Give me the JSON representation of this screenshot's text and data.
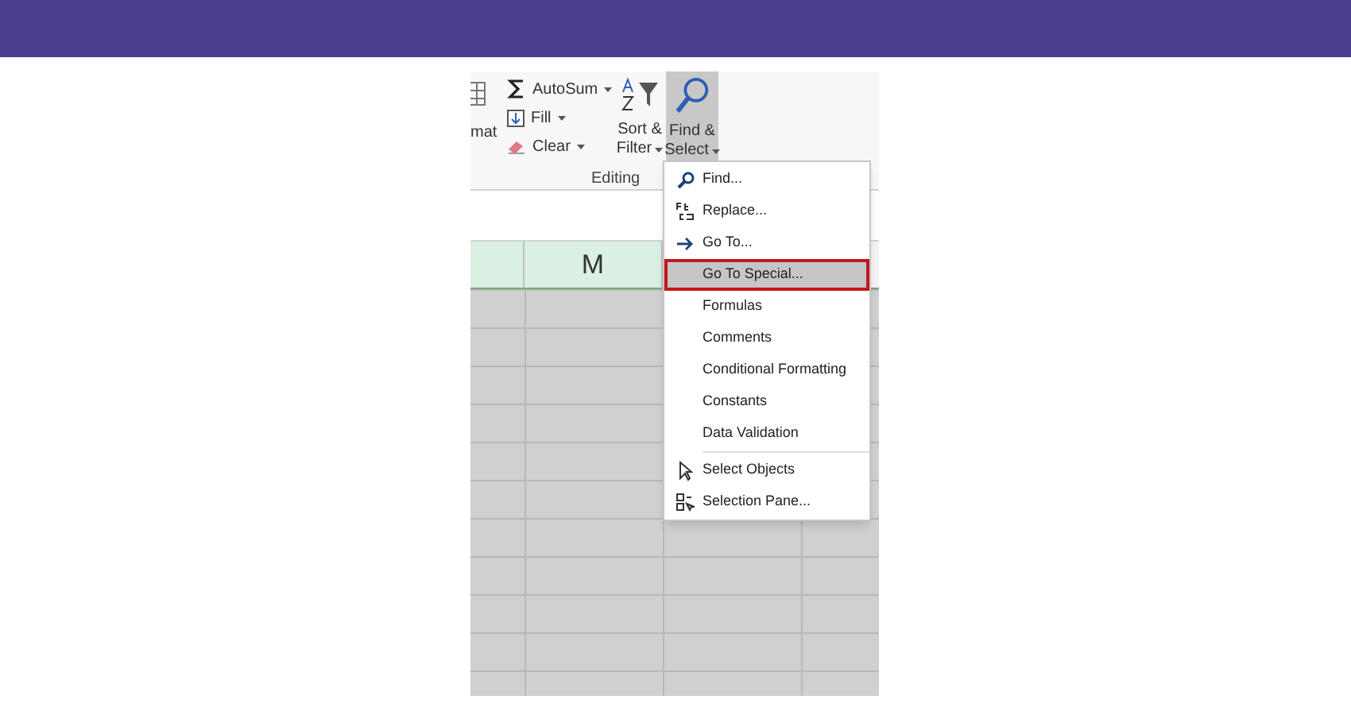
{
  "ribbon": {
    "cut_label": "mat",
    "buttons": [
      {
        "label": "AutoSum",
        "kind": "sum",
        "dropdown": true
      },
      {
        "label": "Fill",
        "kind": "fill",
        "dropdown": true
      },
      {
        "label": "Clear",
        "kind": "clear",
        "dropdown": true
      }
    ],
    "big_buttons": [
      {
        "line1": "Sort &",
        "line2": "Filter",
        "kind": "sort",
        "selected": false
      },
      {
        "line1": "Find &",
        "line2": "Select",
        "kind": "find",
        "selected": true
      }
    ],
    "group_label": "Editing"
  },
  "sheet": {
    "column_header": "M"
  },
  "menu": {
    "items": [
      {
        "label": "Find...",
        "kind": "find",
        "selected": false
      },
      {
        "label": "Replace...",
        "kind": "replace",
        "selected": false
      },
      {
        "label": "Go To...",
        "kind": "goto",
        "selected": false
      },
      {
        "label": "Go To Special...",
        "kind": "none",
        "selected": true
      },
      {
        "label": "Formulas",
        "kind": "none",
        "selected": false
      },
      {
        "label": "Comments",
        "kind": "none",
        "selected": false
      },
      {
        "label": "Conditional Formatting",
        "kind": "none",
        "selected": false
      },
      {
        "label": "Constants",
        "kind": "none",
        "selected": false
      },
      {
        "label": "Data Validation",
        "kind": "none",
        "selected": false
      },
      {
        "label": "Select Objects",
        "kind": "pointer",
        "selected": false,
        "separator_before": true
      },
      {
        "label": "Selection Pane...",
        "kind": "pane",
        "selected": false
      }
    ]
  }
}
